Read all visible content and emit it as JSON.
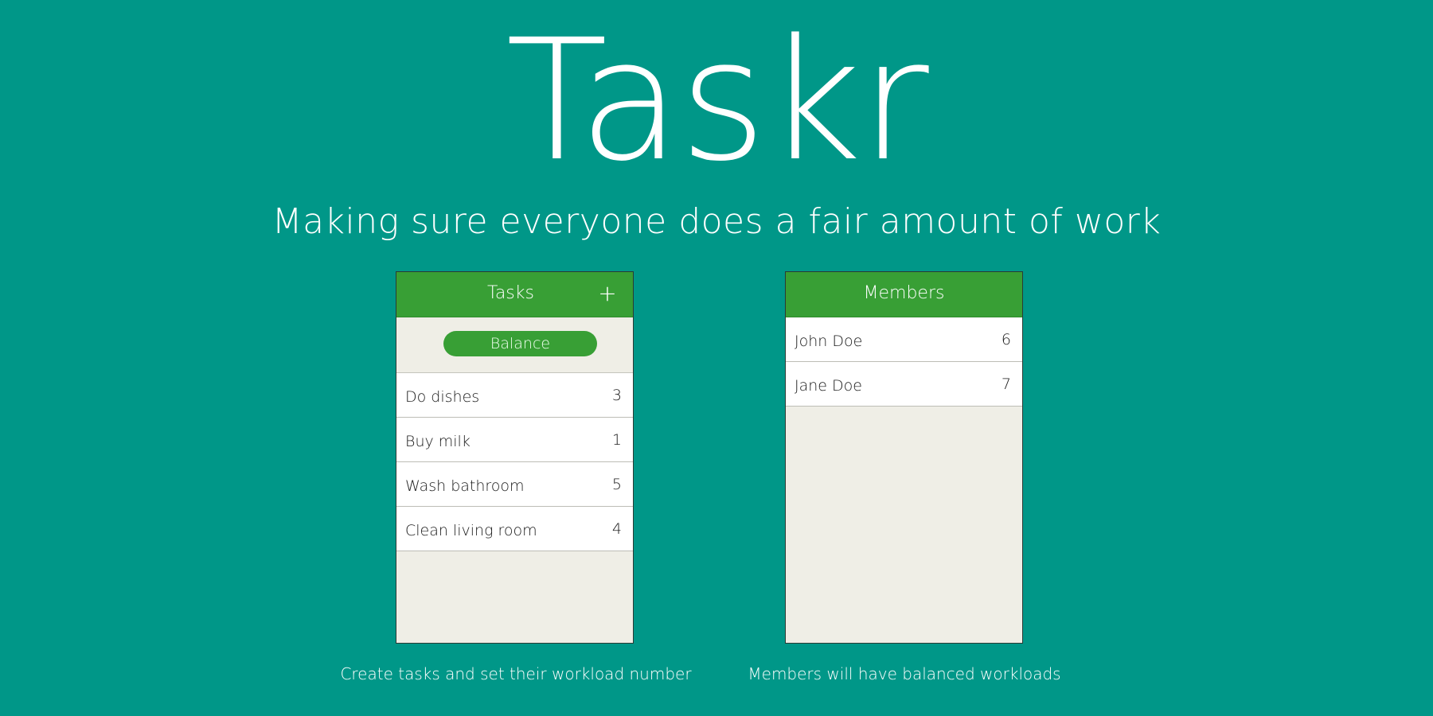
{
  "app": {
    "title": "Taskr",
    "subtitle": "Making sure everyone does a fair amount of work"
  },
  "colors": {
    "background": "#009788",
    "accent": "#389f35",
    "panel": "#efeee6"
  },
  "tasks_screen": {
    "title": "Tasks",
    "add_icon": "+",
    "balance_label": "Balance",
    "items": [
      {
        "name": "Do dishes",
        "value": "3"
      },
      {
        "name": "Buy milk",
        "value": "1"
      },
      {
        "name": "Wash bathroom",
        "value": "5"
      },
      {
        "name": "Clean living room",
        "value": "4"
      }
    ],
    "caption": "Create tasks and set their workload number"
  },
  "members_screen": {
    "title": "Members",
    "items": [
      {
        "name": "John Doe",
        "value": "6"
      },
      {
        "name": "Jane Doe",
        "value": "7"
      }
    ],
    "caption": "Members will have balanced workloads"
  }
}
